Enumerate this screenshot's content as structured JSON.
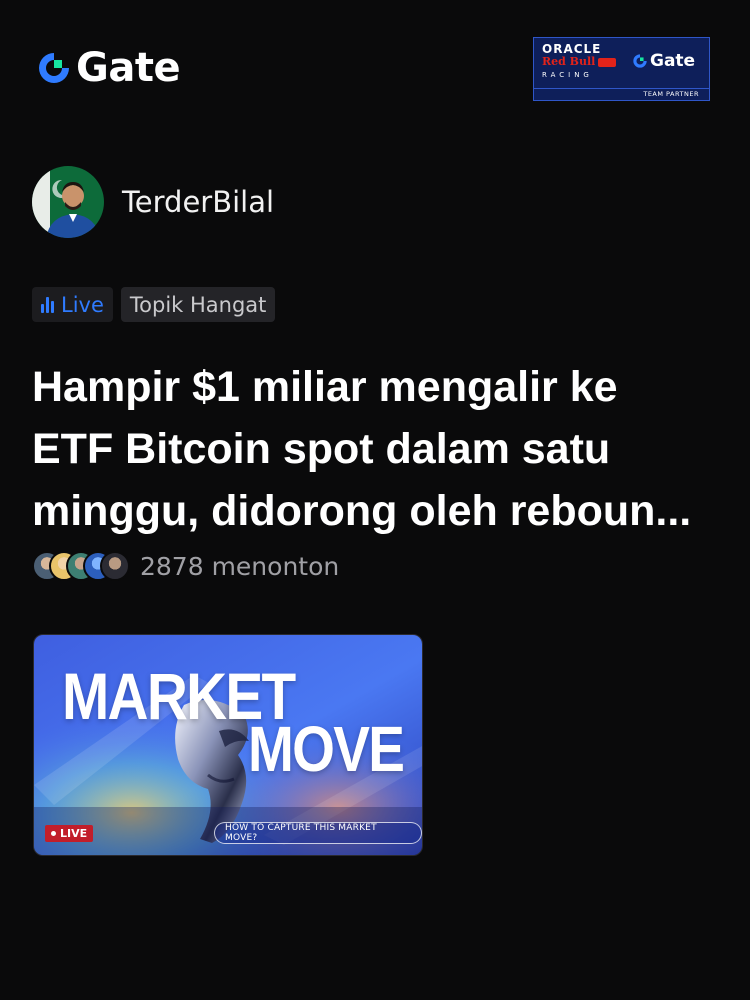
{
  "header": {
    "brand_name": "Gate",
    "partner": {
      "oracle": "ORACLE",
      "redbull": "Red Bull",
      "racing": "RACING",
      "gate": "Gate",
      "team_partner": "TEAM PARTNER"
    }
  },
  "author": {
    "name": "TerderBilal"
  },
  "tags": {
    "live_label": "Live",
    "topic_label": "Topik Hangat"
  },
  "post": {
    "headline_lines": [
      "Hampir $1 miliar mengalir ke",
      "ETF Bitcoin spot dalam satu",
      "minggu, didorong oleh reboun..."
    ],
    "viewer_count": "2878 menonton"
  },
  "live_card": {
    "title_line1": "MARKET",
    "title_line2": "MOVE",
    "live_badge": "LIVE",
    "cta": "HOW TO CAPTURE THIS MARKET MOVE?"
  },
  "colors": {
    "background": "#0a0a0b",
    "brand_blue": "#2f7bff",
    "brand_green": "#17e5a0",
    "live_red": "#c21e2a"
  },
  "icons": [
    "gate-logo-icon",
    "live-bars-icon",
    "avatar-icon",
    "viewer-avatar-icon"
  ]
}
